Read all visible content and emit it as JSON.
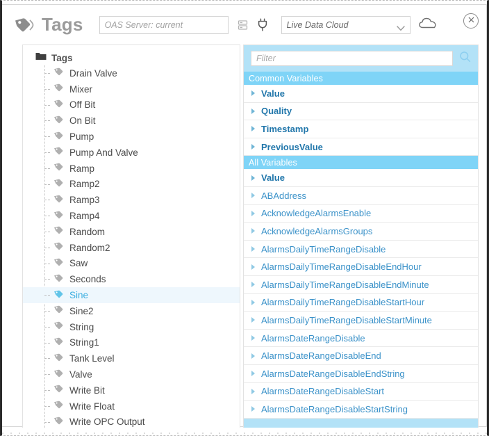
{
  "window": {
    "title": "Tags",
    "title_icon": "tag-icon",
    "close_label": "×"
  },
  "toolbar": {
    "server_input_value": "",
    "server_input_placeholder": "OAS Server: current",
    "database_icon": "database-icon",
    "plug_icon": "plug-icon",
    "mode_selected": "Live Data Cloud",
    "mode_options": [
      "Live Data Cloud"
    ],
    "cloud_icon": "cloud-icon"
  },
  "tree": {
    "root_label": "Tags",
    "root_icon": "folder-open-icon",
    "selected": "Sine",
    "items": [
      {
        "label": "Drain Valve"
      },
      {
        "label": "Mixer"
      },
      {
        "label": "Off Bit"
      },
      {
        "label": "On Bit"
      },
      {
        "label": "Pump"
      },
      {
        "label": "Pump And Valve"
      },
      {
        "label": "Ramp"
      },
      {
        "label": "Ramp2"
      },
      {
        "label": "Ramp3"
      },
      {
        "label": "Ramp4"
      },
      {
        "label": "Random"
      },
      {
        "label": "Random2"
      },
      {
        "label": "Saw"
      },
      {
        "label": "Seconds"
      },
      {
        "label": "Sine"
      },
      {
        "label": "Sine2"
      },
      {
        "label": "String"
      },
      {
        "label": "String1"
      },
      {
        "label": "Tank Level"
      },
      {
        "label": "Valve"
      },
      {
        "label": "Write Bit"
      },
      {
        "label": "Write Float"
      },
      {
        "label": "Write OPC Output"
      }
    ]
  },
  "variables": {
    "filter_value": "",
    "filter_placeholder": "Filter",
    "search_icon": "search-icon",
    "groups": [
      {
        "title": "Common Variables",
        "items": [
          {
            "label": "Value",
            "bold": true
          },
          {
            "label": "Quality",
            "bold": true
          },
          {
            "label": "Timestamp",
            "bold": true
          },
          {
            "label": "PreviousValue",
            "bold": true
          }
        ]
      },
      {
        "title": "All Variables",
        "items": [
          {
            "label": "Value",
            "bold": true
          },
          {
            "label": "ABAddress",
            "bold": false
          },
          {
            "label": "AcknowledgeAlarmsEnable",
            "bold": false
          },
          {
            "label": "AcknowledgeAlarmsGroups",
            "bold": false
          },
          {
            "label": "AlarmsDailyTimeRangeDisable",
            "bold": false
          },
          {
            "label": "AlarmsDailyTimeRangeDisableEndHour",
            "bold": false
          },
          {
            "label": "AlarmsDailyTimeRangeDisableEndMinute",
            "bold": false
          },
          {
            "label": "AlarmsDailyTimeRangeDisableStartHour",
            "bold": false
          },
          {
            "label": "AlarmsDailyTimeRangeDisableStartMinute",
            "bold": false
          },
          {
            "label": "AlarmsDateRangeDisable",
            "bold": false
          },
          {
            "label": "AlarmsDateRangeDisableEnd",
            "bold": false
          },
          {
            "label": "AlarmsDateRangeDisableEndString",
            "bold": false
          },
          {
            "label": "AlarmsDateRangeDisableStart",
            "bold": false
          },
          {
            "label": "AlarmsDateRangeDisableStartString",
            "bold": false
          }
        ]
      }
    ]
  },
  "colors": {
    "accent_blue": "#7fd4f7",
    "pane_blue": "#b3e2f7",
    "link_blue": "#3b92c9",
    "selected_row": "#eef7fd",
    "title_gray": "#9b9b9b"
  }
}
